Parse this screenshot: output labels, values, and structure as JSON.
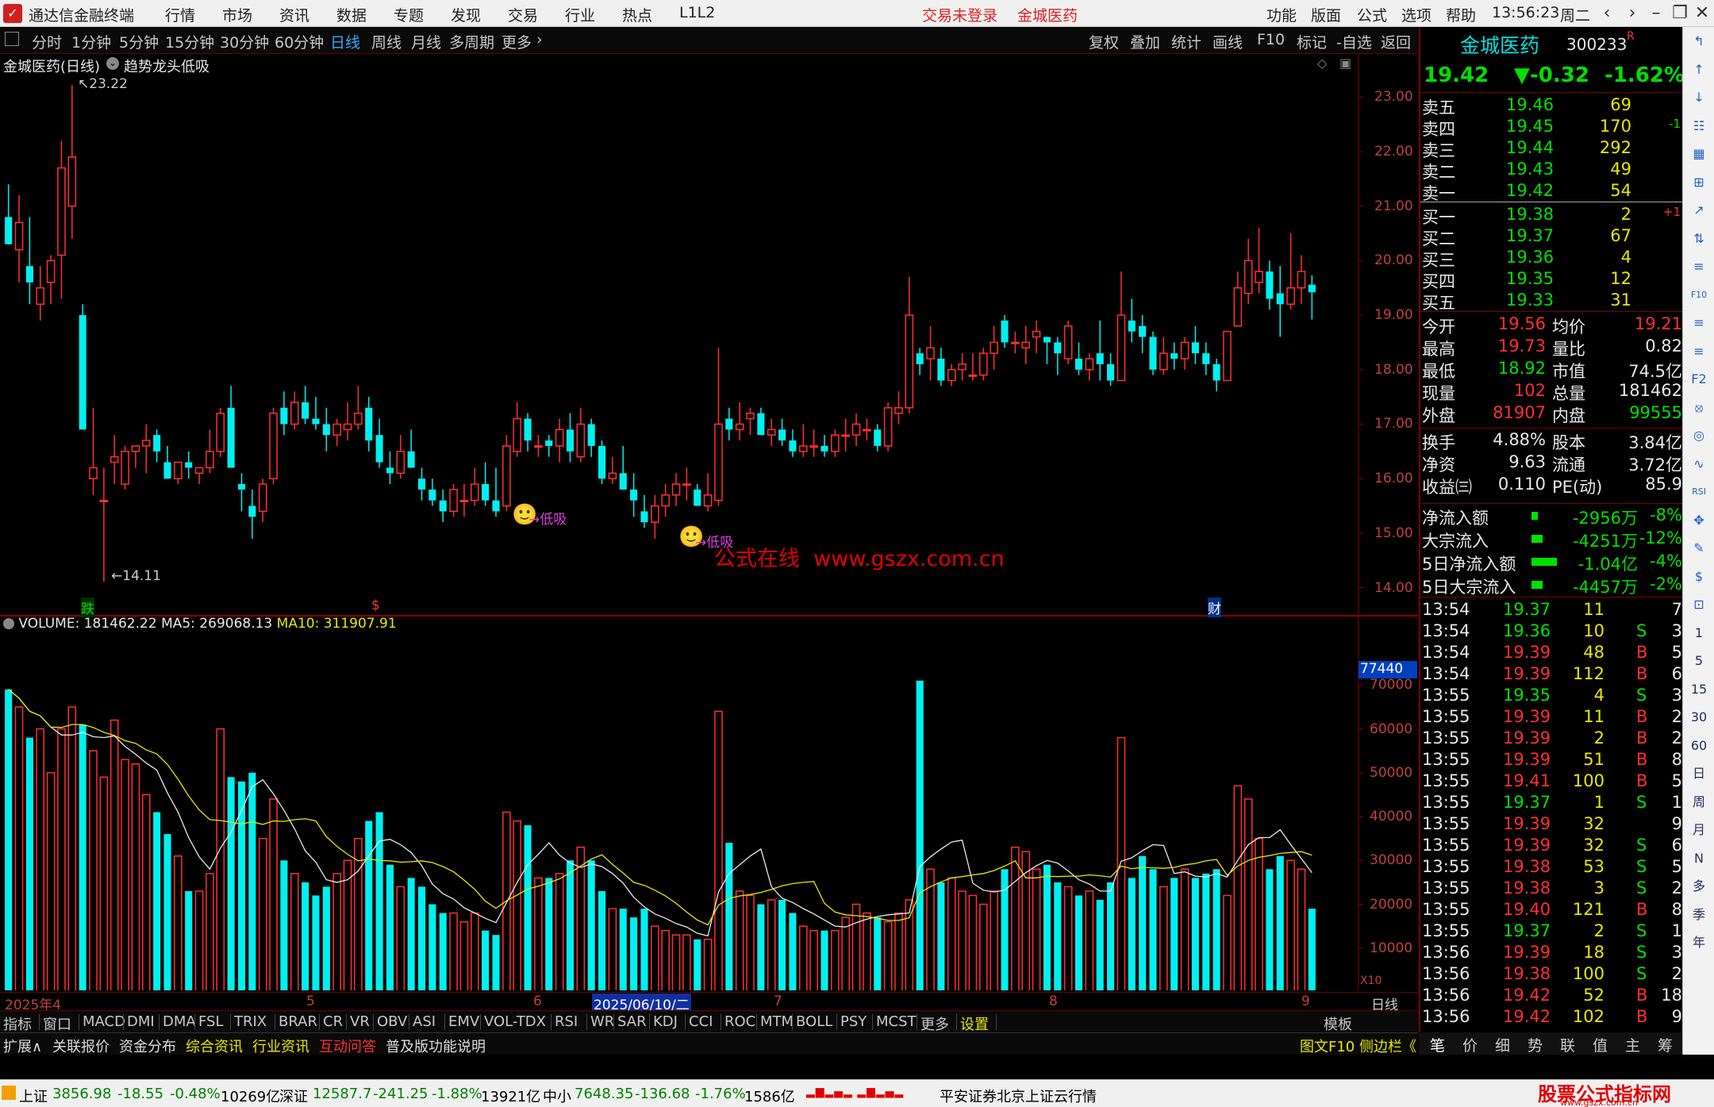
{
  "menubar": {
    "app_title": "通达信金融终端",
    "menus": [
      "行情",
      "市场",
      "资讯",
      "数据",
      "专题",
      "发现",
      "交易",
      "行业",
      "热点",
      "L1L2"
    ],
    "login_status": "交易未登录",
    "stock_name": "金城医药",
    "right_menus": [
      "功能",
      "版面",
      "公式",
      "选项",
      "帮助"
    ],
    "clock": "13:56:23",
    "weekday": "周二"
  },
  "toolbar": {
    "periods": [
      "分时",
      "1分钟",
      "5分钟",
      "15分钟",
      "30分钟",
      "60分钟",
      "日线",
      "周线",
      "月线",
      "多周期",
      "更多"
    ],
    "active_period": "日线",
    "right_buttons": [
      "复权",
      "叠加",
      "统计",
      "画线",
      "F10",
      "标记",
      "-自选",
      "返回"
    ]
  },
  "chart": {
    "title": "金城医药(日线)",
    "indicator_name": "趋势龙头低吸",
    "high_label": "23.22",
    "low_label": "14.11",
    "signal_label": "低吸",
    "watermark": "公式在线  www.gszx.com.cn",
    "marker_die": "跌",
    "marker_s": "$",
    "marker_cai": "财",
    "price_ticks": [
      "23.00",
      "22.00",
      "21.00",
      "20.00",
      "19.00",
      "18.00",
      "17.00",
      "16.00",
      "15.00",
      "14.00"
    ],
    "volume_legend": {
      "volume": "VOLUME: 181462.22",
      "ma5": "MA5: 269068.13",
      "ma10": "MA10: 311907.91"
    },
    "vol_ticks": [
      "70000",
      "60000",
      "50000",
      "40000",
      "30000",
      "20000",
      "10000"
    ],
    "vol_cursor_label": "77440",
    "vol_unit": "X10",
    "date_axis": [
      "2025年4",
      "5",
      "6",
      "2025/06/10/二",
      "7",
      "8",
      "9"
    ],
    "axis_period": "日线"
  },
  "chart_data": {
    "type": "candlestick",
    "ylim": [
      13.6,
      23.5
    ],
    "vol_ylim": [
      0,
      80000
    ],
    "candles": [
      [
        20.8,
        21.4,
        20.3,
        20.3
      ],
      [
        20.2,
        21.2,
        19.6,
        20.7
      ],
      [
        19.9,
        20.8,
        19.2,
        19.6
      ],
      [
        19.2,
        19.9,
        18.9,
        19.5
      ],
      [
        19.6,
        20.1,
        19.2,
        20.0
      ],
      [
        20.1,
        22.2,
        19.3,
        21.7
      ],
      [
        21.0,
        23.22,
        20.4,
        21.9
      ],
      [
        19.0,
        19.2,
        16.9,
        16.9
      ],
      [
        16.0,
        17.3,
        15.7,
        16.2
      ],
      [
        15.6,
        16.2,
        14.11,
        15.6
      ],
      [
        16.3,
        16.8,
        15.9,
        16.4
      ],
      [
        15.9,
        16.6,
        15.8,
        16.5
      ],
      [
        16.5,
        16.6,
        16.2,
        16.6
      ],
      [
        16.6,
        17.0,
        16.1,
        16.7
      ],
      [
        16.8,
        16.9,
        16.3,
        16.5
      ],
      [
        16.3,
        16.6,
        16.0,
        16.0
      ],
      [
        16.0,
        16.3,
        15.9,
        16.3
      ],
      [
        16.3,
        16.5,
        16.0,
        16.2
      ],
      [
        16.1,
        16.2,
        15.9,
        16.2
      ],
      [
        16.2,
        16.9,
        16.1,
        16.5
      ],
      [
        16.5,
        17.3,
        16.4,
        17.2
      ],
      [
        17.3,
        17.7,
        16.2,
        16.2
      ],
      [
        15.9,
        16.1,
        15.4,
        15.8
      ],
      [
        15.5,
        15.8,
        14.9,
        15.3
      ],
      [
        15.4,
        16.0,
        15.2,
        15.9
      ],
      [
        16.0,
        17.3,
        15.9,
        17.2
      ],
      [
        17.3,
        17.6,
        16.8,
        17.0
      ],
      [
        17.0,
        17.6,
        16.9,
        17.4
      ],
      [
        17.4,
        17.7,
        17.0,
        17.1
      ],
      [
        17.1,
        17.5,
        16.9,
        17.0
      ],
      [
        17.0,
        17.3,
        16.5,
        16.8
      ],
      [
        16.8,
        17.1,
        16.6,
        17.0
      ],
      [
        16.9,
        17.4,
        16.7,
        17.0
      ],
      [
        17.0,
        17.7,
        16.9,
        17.2
      ],
      [
        17.3,
        17.5,
        16.5,
        16.7
      ],
      [
        16.8,
        17.1,
        16.2,
        16.3
      ],
      [
        16.2,
        16.5,
        15.9,
        16.1
      ],
      [
        16.1,
        16.8,
        16.0,
        16.5
      ],
      [
        16.5,
        16.9,
        16.2,
        16.2
      ],
      [
        16.0,
        16.2,
        15.6,
        15.8
      ],
      [
        15.8,
        16.0,
        15.5,
        15.6
      ],
      [
        15.6,
        15.8,
        15.2,
        15.4
      ],
      [
        15.4,
        15.9,
        15.3,
        15.8
      ],
      [
        15.6,
        15.9,
        15.3,
        15.6
      ],
      [
        15.6,
        16.2,
        15.5,
        15.9
      ],
      [
        15.9,
        16.3,
        15.5,
        15.6
      ],
      [
        15.6,
        16.2,
        15.3,
        15.4
      ],
      [
        15.5,
        16.8,
        15.4,
        16.6
      ],
      [
        16.5,
        17.4,
        16.4,
        17.1
      ],
      [
        17.1,
        17.2,
        16.5,
        16.7
      ],
      [
        16.6,
        16.8,
        16.4,
        16.6
      ],
      [
        16.7,
        16.8,
        16.4,
        16.6
      ],
      [
        16.6,
        17.1,
        16.3,
        16.9
      ],
      [
        16.9,
        17.2,
        16.3,
        16.5
      ],
      [
        16.4,
        17.3,
        16.3,
        17.0
      ],
      [
        17.0,
        17.1,
        16.4,
        16.6
      ],
      [
        16.6,
        16.7,
        15.9,
        16.0
      ],
      [
        16.0,
        16.4,
        15.9,
        16.1
      ],
      [
        16.1,
        16.6,
        15.8,
        15.8
      ],
      [
        15.8,
        16.1,
        15.3,
        15.6
      ],
      [
        15.4,
        15.7,
        15.1,
        15.2
      ],
      [
        15.2,
        15.7,
        14.9,
        15.5
      ],
      [
        15.5,
        15.9,
        15.3,
        15.7
      ],
      [
        15.7,
        16.1,
        15.5,
        15.9
      ],
      [
        15.9,
        16.2,
        15.6,
        15.9
      ],
      [
        15.8,
        15.9,
        15.5,
        15.5
      ],
      [
        15.5,
        16.1,
        15.4,
        15.7
      ],
      [
        15.6,
        18.4,
        15.5,
        17.0
      ],
      [
        17.1,
        17.3,
        16.7,
        16.9
      ],
      [
        16.9,
        17.4,
        16.7,
        17.0
      ],
      [
        17.1,
        17.3,
        16.8,
        17.2
      ],
      [
        17.2,
        17.3,
        16.8,
        16.8
      ],
      [
        16.8,
        17.1,
        16.6,
        16.9
      ],
      [
        16.9,
        17.1,
        16.6,
        16.7
      ],
      [
        16.7,
        16.9,
        16.4,
        16.5
      ],
      [
        16.5,
        17.0,
        16.4,
        16.6
      ],
      [
        16.6,
        16.9,
        16.4,
        16.6
      ],
      [
        16.6,
        16.8,
        16.4,
        16.5
      ],
      [
        16.5,
        16.9,
        16.4,
        16.8
      ],
      [
        16.8,
        17.1,
        16.5,
        16.8
      ],
      [
        16.8,
        17.2,
        16.6,
        17.0
      ],
      [
        16.9,
        17.1,
        16.7,
        16.9
      ],
      [
        16.9,
        17.0,
        16.5,
        16.6
      ],
      [
        16.6,
        17.4,
        16.5,
        17.3
      ],
      [
        17.2,
        17.6,
        17.0,
        17.3
      ],
      [
        17.3,
        19.7,
        17.2,
        19.0
      ],
      [
        18.3,
        18.4,
        17.9,
        18.1
      ],
      [
        18.2,
        18.8,
        17.8,
        18.4
      ],
      [
        18.2,
        18.4,
        17.7,
        17.8
      ],
      [
        17.8,
        18.1,
        17.7,
        18.0
      ],
      [
        18.0,
        18.3,
        17.8,
        18.1
      ],
      [
        17.9,
        18.3,
        17.8,
        17.9
      ],
      [
        17.9,
        18.4,
        17.8,
        18.3
      ],
      [
        18.3,
        18.8,
        18.0,
        18.5
      ],
      [
        18.9,
        19.0,
        18.4,
        18.5
      ],
      [
        18.5,
        18.7,
        18.3,
        18.5
      ],
      [
        18.4,
        18.8,
        18.1,
        18.5
      ],
      [
        18.6,
        18.9,
        18.3,
        18.7
      ],
      [
        18.6,
        18.6,
        18.1,
        18.5
      ],
      [
        18.5,
        18.6,
        17.9,
        18.3
      ],
      [
        18.2,
        18.9,
        18.1,
        18.8
      ],
      [
        18.2,
        18.5,
        17.9,
        18.0
      ],
      [
        18.0,
        18.3,
        17.8,
        18.2
      ],
      [
        18.3,
        18.9,
        17.8,
        18.1
      ],
      [
        18.1,
        18.3,
        17.7,
        17.8
      ],
      [
        17.8,
        19.8,
        17.8,
        19.0
      ],
      [
        18.9,
        19.3,
        18.5,
        18.7
      ],
      [
        18.8,
        19.0,
        18.3,
        18.6
      ],
      [
        18.6,
        18.7,
        17.9,
        18.0
      ],
      [
        18.0,
        18.6,
        17.9,
        18.3
      ],
      [
        18.3,
        18.5,
        18.0,
        18.2
      ],
      [
        18.2,
        18.6,
        18.0,
        18.5
      ],
      [
        18.5,
        18.8,
        18.1,
        18.3
      ],
      [
        18.3,
        18.5,
        17.9,
        18.1
      ],
      [
        18.1,
        18.2,
        17.6,
        17.8
      ],
      [
        17.8,
        18.7,
        17.8,
        18.7
      ],
      [
        18.8,
        19.8,
        18.8,
        19.5
      ],
      [
        19.4,
        20.4,
        19.2,
        20.0
      ],
      [
        19.6,
        20.6,
        19.4,
        19.8
      ],
      [
        19.8,
        20.0,
        19.1,
        19.3
      ],
      [
        19.4,
        19.9,
        18.6,
        19.2
      ],
      [
        19.2,
        20.5,
        19.1,
        19.5
      ],
      [
        19.5,
        20.1,
        19.2,
        19.8
      ],
      [
        19.56,
        19.73,
        18.92,
        19.42
      ]
    ],
    "volumes": [
      69000,
      65000,
      58000,
      60000,
      50000,
      60000,
      65000,
      61000,
      55000,
      49000,
      62000,
      53000,
      52000,
      45000,
      41000,
      36000,
      31000,
      23000,
      23000,
      27000,
      60000,
      49000,
      48000,
      50000,
      35000,
      44000,
      30000,
      27000,
      25000,
      22000,
      24000,
      27000,
      30000,
      35000,
      39000,
      41000,
      29000,
      24000,
      26000,
      24000,
      20000,
      18000,
      18000,
      16000,
      18000,
      14000,
      13000,
      41000,
      39000,
      38000,
      26000,
      26000,
      27000,
      30000,
      33000,
      30000,
      23000,
      19000,
      19000,
      17000,
      19000,
      15000,
      14000,
      13000,
      13000,
      12000,
      12000,
      64000,
      34000,
      23000,
      22000,
      20000,
      21000,
      21000,
      18000,
      15000,
      14000,
      14000,
      14000,
      17000,
      20000,
      18000,
      17000,
      16000,
      18000,
      21000,
      71000,
      28000,
      25000,
      26000,
      23000,
      22000,
      20000,
      23000,
      28000,
      33000,
      32000,
      28000,
      29000,
      25000,
      24000,
      22000,
      23000,
      21000,
      25000,
      58000,
      26000,
      31000,
      28000,
      24000,
      26000,
      28000,
      26000,
      27000,
      28000,
      22000,
      47000,
      44000,
      35000,
      28000,
      31000,
      30000,
      28000,
      19000
    ]
  },
  "quote": {
    "name": "金城医药",
    "code": "300233",
    "flag": "R",
    "price": "19.42",
    "change": "▼-0.32",
    "pct": "-1.62%",
    "asks": [
      [
        "卖五",
        "19.46",
        "69",
        ""
      ],
      [
        "卖四",
        "19.45",
        "170",
        "-1"
      ],
      [
        "卖三",
        "19.44",
        "292",
        ""
      ],
      [
        "卖二",
        "19.43",
        "49",
        ""
      ],
      [
        "卖一",
        "19.42",
        "54",
        ""
      ]
    ],
    "bids": [
      [
        "买一",
        "19.38",
        "2",
        "+1"
      ],
      [
        "买二",
        "19.37",
        "67",
        ""
      ],
      [
        "买三",
        "19.36",
        "4",
        ""
      ],
      [
        "买四",
        "19.35",
        "12",
        ""
      ],
      [
        "买五",
        "19.33",
        "31",
        ""
      ]
    ],
    "stats": [
      [
        "今开",
        "19.56",
        "均价",
        "19.21"
      ],
      [
        "最高",
        "19.73",
        "量比",
        "0.82"
      ],
      [
        "最低",
        "18.92",
        "市值",
        "74.5亿"
      ],
      [
        "现量",
        "102",
        "总量",
        "181462"
      ],
      [
        "外盘",
        "81907",
        "内盘",
        "99555"
      ]
    ],
    "stats2": [
      [
        "换手",
        "4.88%",
        "股本",
        "3.84亿"
      ],
      [
        "净资",
        "9.63",
        "流通",
        "3.72亿"
      ],
      [
        "收益㈢",
        "0.110",
        "PE(动)",
        "85.9"
      ]
    ],
    "flows": [
      [
        "净流入额",
        "-2956万",
        "-8%"
      ],
      [
        "大宗流入",
        "-4251万",
        "-12%"
      ],
      [
        "5日净流入额",
        "-1.04亿",
        "-4%"
      ],
      [
        "5日大宗流入",
        "-4457万",
        "-2%"
      ]
    ],
    "ticks": [
      [
        "13:54",
        "19.37",
        "11",
        "",
        "7"
      ],
      [
        "13:54",
        "19.36",
        "10",
        "S",
        "3"
      ],
      [
        "13:54",
        "19.39",
        "48",
        "B",
        "5"
      ],
      [
        "13:54",
        "19.39",
        "112",
        "B",
        "6"
      ],
      [
        "13:55",
        "19.35",
        "4",
        "S",
        "3"
      ],
      [
        "13:55",
        "19.39",
        "11",
        "B",
        "2"
      ],
      [
        "13:55",
        "19.39",
        "2",
        "B",
        "2"
      ],
      [
        "13:55",
        "19.39",
        "51",
        "B",
        "8"
      ],
      [
        "13:55",
        "19.41",
        "100",
        "B",
        "5"
      ],
      [
        "13:55",
        "19.37",
        "1",
        "S",
        "1"
      ],
      [
        "13:55",
        "19.39",
        "32",
        "",
        "9"
      ],
      [
        "13:55",
        "19.39",
        "32",
        "S",
        "6"
      ],
      [
        "13:55",
        "19.38",
        "53",
        "S",
        "5"
      ],
      [
        "13:55",
        "19.38",
        "3",
        "S",
        "2"
      ],
      [
        "13:55",
        "19.40",
        "121",
        "B",
        "8"
      ],
      [
        "13:55",
        "19.37",
        "2",
        "S",
        "1"
      ],
      [
        "13:56",
        "19.39",
        "18",
        "S",
        "3"
      ],
      [
        "13:56",
        "19.38",
        "100",
        "S",
        "2"
      ],
      [
        "13:56",
        "19.42",
        "52",
        "B",
        "18"
      ],
      [
        "13:56",
        "19.42",
        "102",
        "B",
        "9"
      ]
    ]
  },
  "bottom_tabs": [
    "笔",
    "价",
    "细",
    "势",
    "联",
    "值",
    "主",
    "筹"
  ],
  "indicator_tabs": [
    "指标",
    "窗口",
    "MACD",
    "DMI",
    "DMA",
    "FSL",
    "TRIX",
    "BRAR",
    "CR",
    "VR",
    "OBV",
    "ASI",
    "EMV",
    "VOL-TDX",
    "RSI",
    "WR",
    "SAR",
    "KDJ",
    "CCI",
    "ROC",
    "MTM",
    "BOLL",
    "PSY",
    "MCST",
    "更多",
    "设置"
  ],
  "template_btn": "模板",
  "sub_tabs": [
    "扩展∧",
    "关联报价",
    "资金分布",
    "综合资讯",
    "行业资讯",
    "互动问答",
    "普及版功能说明"
  ],
  "sub_right": "图文F10 侧边栏《",
  "rightstrip_icons": [
    "↰",
    "↑",
    "↓",
    "☷",
    "▦",
    "⊞",
    "↗",
    "⇅",
    "≡",
    "F10",
    "≡",
    "≡",
    "F2",
    "⦻",
    "◎",
    "∿",
    "RSI",
    "✥",
    "✎",
    "$",
    "⊡",
    "1",
    "5",
    "15",
    "30",
    "60",
    "日",
    "周",
    "月",
    "N",
    "多",
    "季",
    "年"
  ],
  "statusbar": {
    "sh_name": "上证",
    "sh_val": "3856.98",
    "sh_chg": "-18.55",
    "sh_pct": "-0.48%",
    "sh_amt": "10269亿",
    "sz_name": "深证",
    "sz_val": "12587.7",
    "sz_chg": "-241.25",
    "sz_pct": "-1.88%",
    "sz_amt": "13921亿",
    "zx_name": "中小",
    "zx_val": "7648.35",
    "zx_chg": "-136.68",
    "zx_pct": "-1.76%",
    "zx_amt": "1586亿",
    "broker": "平安证券北京上证云行情",
    "logo_text": "股票公式指标网",
    "logo_url": "www.gszx.com.cn"
  }
}
